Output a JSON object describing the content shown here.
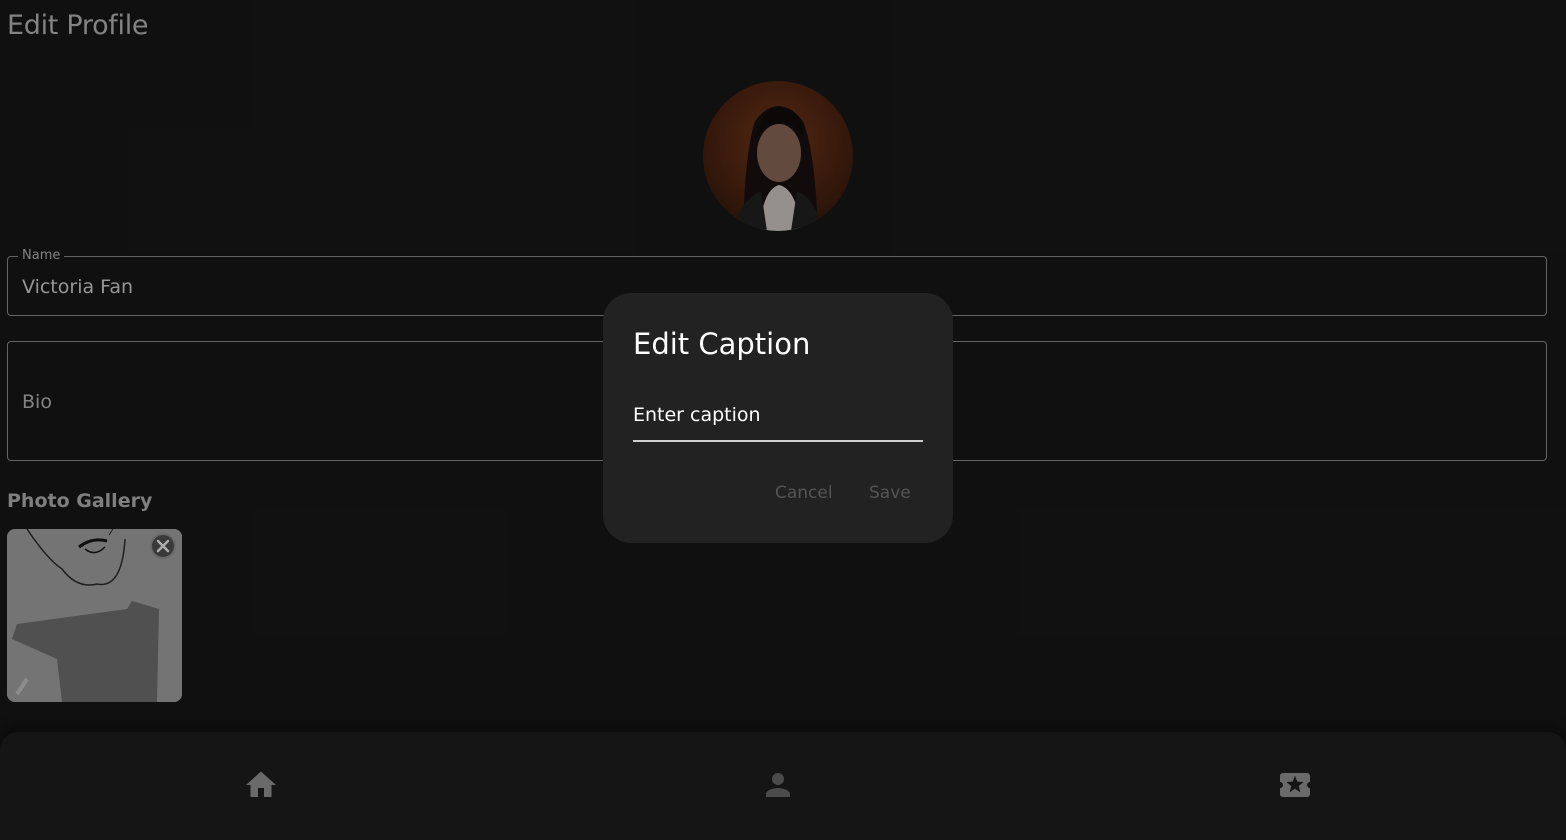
{
  "header": {
    "title": "Edit Profile"
  },
  "profile": {
    "name_label": "Name",
    "name_value": "Victoria Fan",
    "bio_placeholder": "Bio"
  },
  "gallery": {
    "title": "Photo Gallery"
  },
  "dialog": {
    "title": "Edit Caption",
    "input_placeholder": "Enter caption",
    "cancel_label": "Cancel",
    "save_label": "Save"
  },
  "bottom_nav": {
    "items": [
      {
        "icon": "home-icon"
      },
      {
        "icon": "person-icon"
      },
      {
        "icon": "ticket-star-icon"
      }
    ]
  },
  "colors": {
    "background": "#121212",
    "dialog": "#222222",
    "disabled_text": "#555555"
  }
}
